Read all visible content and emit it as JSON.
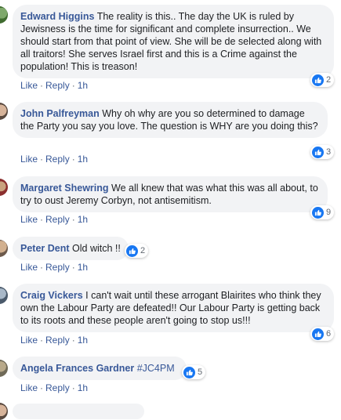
{
  "comments": [
    {
      "author": "Edward Higgins",
      "text": "The reality is this.. The day the UK is ruled by Jewisness is the time for significant and complete insurrection.. We should start from that point of view. She will be de selected along with all traitors! She serves Israel first and this is a Crime against the population! This is treason!",
      "reactions": "2",
      "like": "Like",
      "reply": "Reply",
      "time": "1h"
    },
    {
      "author": "John Palfreyman",
      "text": "Why oh why are you so determined to damage the Party you say you love. The question is WHY are you doing this?",
      "reactions": "3",
      "like": "Like",
      "reply": "Reply",
      "time": "1h"
    },
    {
      "author": "Margaret Shewring",
      "text": "We all knew that was what this was all about, to try to oust Jeremy Corbyn, not antisemitism.",
      "reactions": "9",
      "like": "Like",
      "reply": "Reply",
      "time": "1h"
    },
    {
      "author": "Peter Dent",
      "text": "Old witch !!",
      "reactions": "2",
      "like": "Like",
      "reply": "Reply",
      "time": "1h"
    },
    {
      "author": "Craig Vickers",
      "text": "I can't wait until these arrogant Blairites who think they own the Labour Party are defeated!! Our Labour Party is getting back to its roots and these people aren't going to stop us!!!",
      "reactions": "6",
      "like": "Like",
      "reply": "Reply",
      "time": "1h"
    },
    {
      "author": "Angela Frances Gardner",
      "text": "#JC4PM",
      "reactions": "5",
      "like": "Like",
      "reply": "Reply",
      "time": "1h"
    }
  ],
  "icons": {
    "reaction": "thumbs-up-icon"
  },
  "colors": {
    "name": "#385898",
    "bubble": "#f2f3f5",
    "like": "#1877f2",
    "meta": "#606770"
  }
}
